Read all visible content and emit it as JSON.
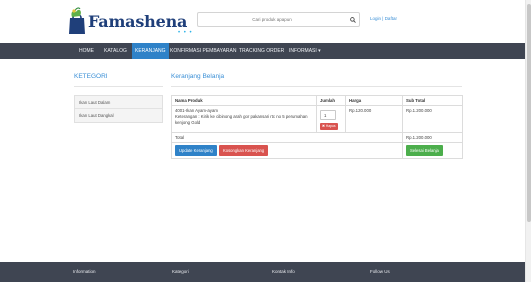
{
  "brand": {
    "name": "Famashena",
    "dots": "• • •"
  },
  "search": {
    "placeholder": "Cari produk apapun"
  },
  "auth": {
    "login": "Login",
    "separator": " | ",
    "daftar": "Daftar"
  },
  "nav": [
    {
      "label": "HOME"
    },
    {
      "label": "KATALOG"
    },
    {
      "label": "KERANJANG"
    },
    {
      "label": "KONFIRMASI PEMBAYARAN"
    },
    {
      "label": "TRACKING ORDER"
    },
    {
      "label": "INFORMASI ▾"
    }
  ],
  "sidebar": {
    "title": "KETEGORI",
    "items": [
      {
        "label": "Ikan Laut Dalam"
      },
      {
        "label": "Ikan Laut Dangkal"
      }
    ]
  },
  "cart": {
    "title": "Keranjang Belanja",
    "headers": {
      "name": "Nama Produk",
      "qty": "Jumlah",
      "price": "Harga",
      "subtotal": "Sub Total"
    },
    "rows": [
      {
        "name": "4001-Ikan Ayam-ayam",
        "note": "Keterangan : Kirik ke cibinong arah gor pakansari rtc no 5 perumahan kenjong Gold",
        "qty": "1",
        "delete_label": "Hapus",
        "price": "Rp.120.000",
        "subtotal": "Rp.1.200.000"
      }
    ],
    "total_label": "Total",
    "total_value": "Rp.1.200.000",
    "update_button": "Update Keranjang",
    "clear_button": "Kosongkan Keranjang",
    "finish_button": "Selesai Belanja"
  },
  "footer": {
    "columns": [
      {
        "label": "Information"
      },
      {
        "label": "Kategori"
      },
      {
        "label": "Kontak Info"
      },
      {
        "label": "Follow Us"
      }
    ]
  },
  "colors": {
    "accent": "#2f82c8",
    "nav_bg": "#3f4552",
    "danger": "#d9534f",
    "success": "#4cae4c"
  }
}
